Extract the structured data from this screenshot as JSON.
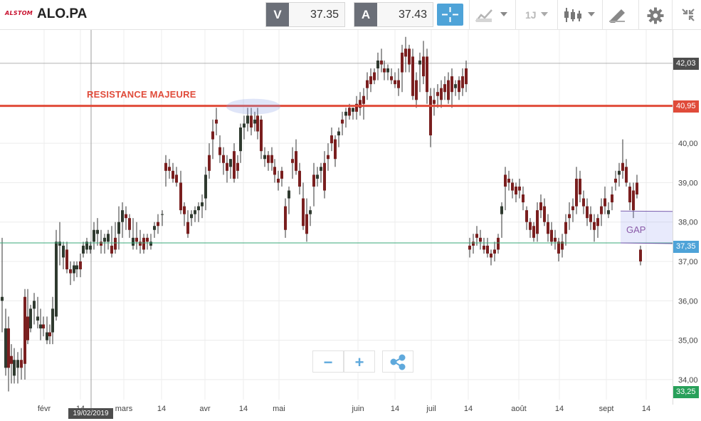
{
  "header": {
    "logo_text": "ALSTOM",
    "symbol": "ALO.PA",
    "sell": {
      "letter": "V",
      "price": "37.35"
    },
    "buy": {
      "letter": "A",
      "price": "37.43"
    },
    "interval": "1J"
  },
  "chart": {
    "y_ticks": [
      "36,00",
      "35,00",
      "34,00",
      "37,00",
      "38,00",
      "39,00",
      "40,00"
    ],
    "x_ticks": [
      "févr",
      "14",
      "mars",
      "14",
      "avr",
      "14",
      "mai",
      "juin",
      "14",
      "juil",
      "14",
      "août",
      "14",
      "sept",
      "14"
    ],
    "price_tags": {
      "high": "42,03",
      "resistance": "40,95",
      "current": "37,35",
      "low": "33,25"
    },
    "date_tag": "19/02/2019",
    "annotations": {
      "resistance_label": "RESISTANCE MAJEURE",
      "gap_label": "GAP"
    },
    "colors": {
      "up": "#2f3a2f",
      "down": "#7a1f1f",
      "resistance": "#e04b3a",
      "current_line": "#3aa97a",
      "high_tag": "#4d4d4d",
      "current_tag": "#4ea3d8",
      "low_tag": "#28a05a",
      "accent": "#4ea3d8"
    }
  },
  "controls": {
    "zoom_out": "−",
    "zoom_in": "+"
  }
}
